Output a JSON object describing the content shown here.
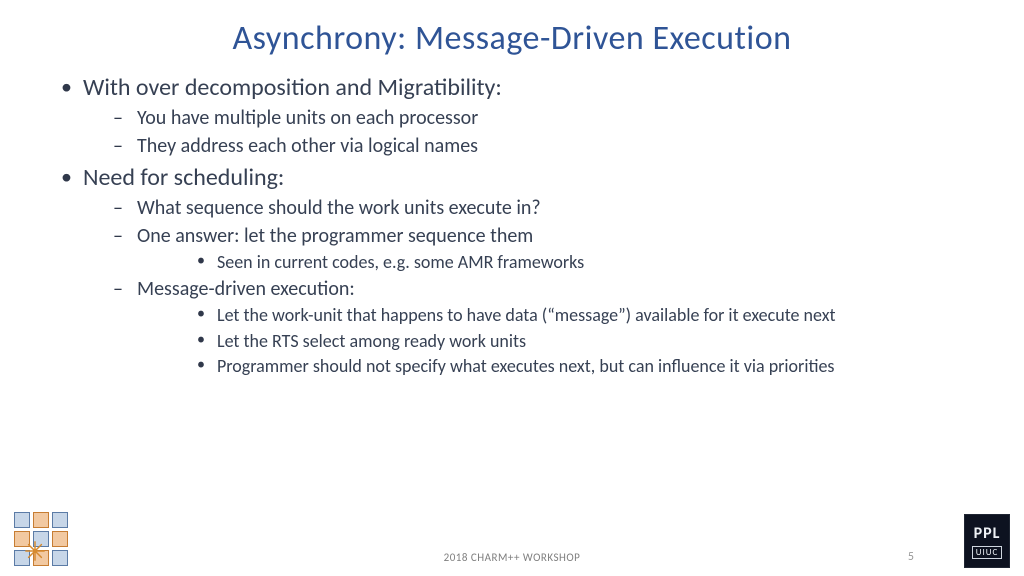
{
  "title": "Asynchrony: Message-Driven Execution",
  "bullets": [
    {
      "text": "With over decomposition and Migratibility:",
      "sub": [
        {
          "text": "You have multiple units on each processor"
        },
        {
          "text": "They address each other via logical names"
        }
      ]
    },
    {
      "text": "Need for scheduling:",
      "sub": [
        {
          "text": "What sequence should the work units execute in?"
        },
        {
          "text": "One answer: let the programmer sequence them",
          "sub": [
            {
              "text": "Seen in current codes, e.g. some AMR frameworks"
            }
          ]
        },
        {
          "text": "Message-driven execution:",
          "sub": [
            {
              "text": "Let the work-unit that happens to have data (“message”) available for it execute next"
            },
            {
              "text": "Let the RTS select among ready work units"
            },
            {
              "text": "Programmer should not specify what executes next, but can influence it via priorities"
            }
          ]
        }
      ]
    }
  ],
  "footer": "2018 CHARM++ WORKSHOP",
  "page": "5",
  "logos": {
    "left_alt": "charm-grid-logo",
    "right_top": "PPL",
    "right_bottom": "UIUC"
  }
}
